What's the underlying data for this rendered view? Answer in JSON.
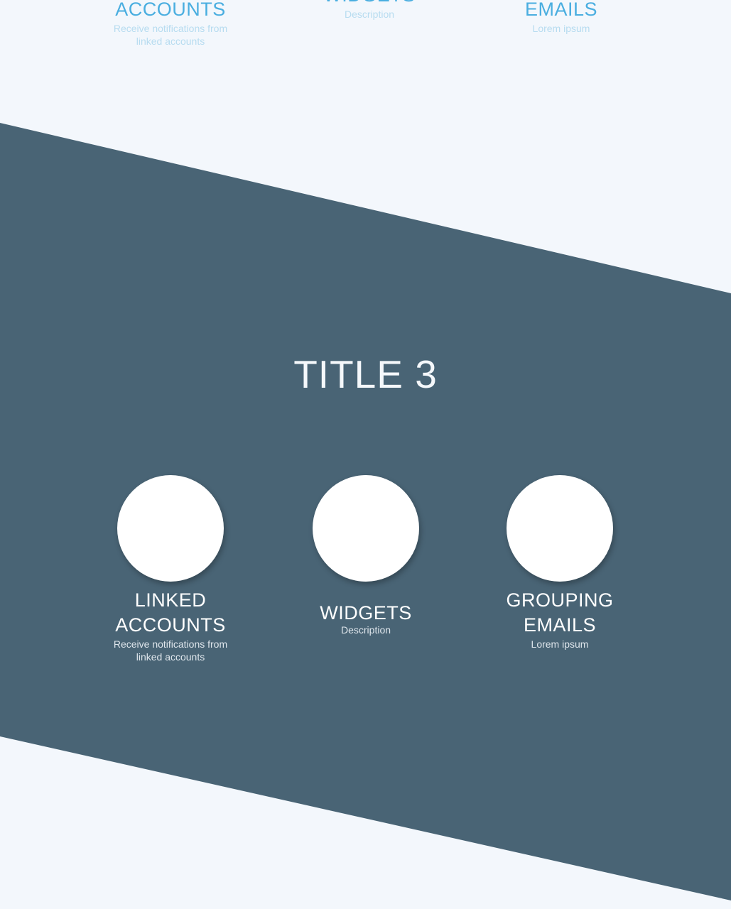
{
  "colors": {
    "background": "#f3f7fc",
    "band": "#496475",
    "accent_title": "#4aaee0",
    "accent_desc": "#b7dcf0",
    "circle": "#ffffff"
  },
  "top_features": [
    {
      "title": "ACCOUNTS",
      "desc": "Receive notifications from linked accounts"
    },
    {
      "title": "WIDGETS",
      "desc": "Description"
    },
    {
      "title": "EMAILS",
      "desc": "Lorem ipsum"
    }
  ],
  "section3": {
    "title": "TITLE 3",
    "features": [
      {
        "title_line1": "LINKED",
        "title_line2": "ACCOUNTS",
        "desc": "Receive notifications from linked accounts"
      },
      {
        "title_line1": "WIDGETS",
        "desc": "Description"
      },
      {
        "title_line1": "GROUPING",
        "title_line2": "EMAILS",
        "desc": "Lorem ipsum"
      }
    ]
  }
}
